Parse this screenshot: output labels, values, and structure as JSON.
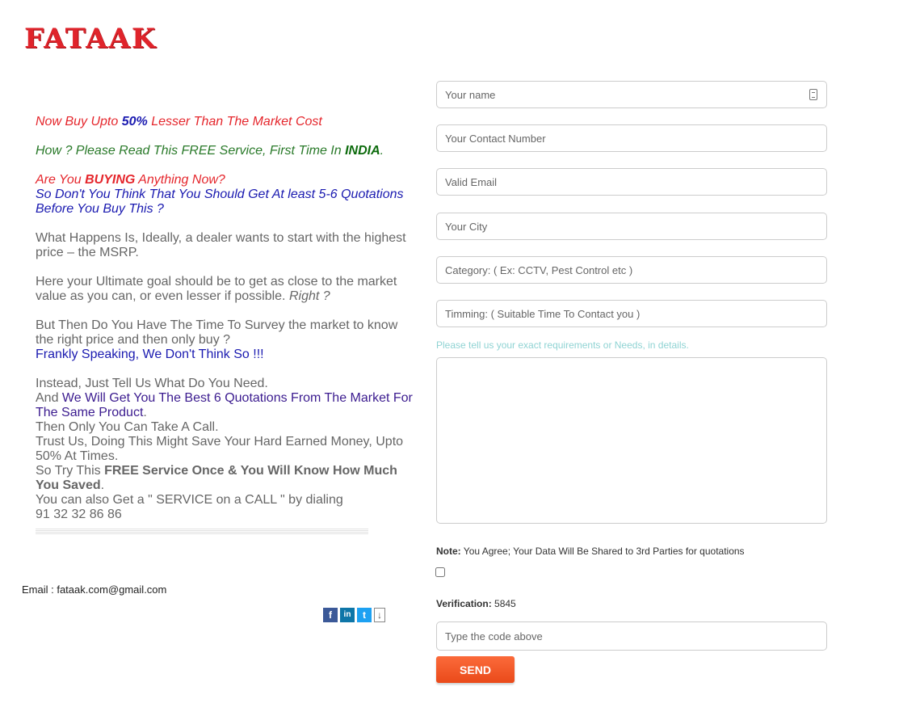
{
  "brand": {
    "logo_text": "FATAAK"
  },
  "pitch": {
    "line1_a": "Now Buy Upto ",
    "line1_b": "50%",
    "line1_c": " Lesser Than The Market Cost",
    "line2_a": "How ? Please Read This FREE Service, First Time In ",
    "line2_b": "INDIA",
    "line2_c": ".",
    "line3_a": "Are You ",
    "line3_b": "BUYING",
    "line3_c": " Anything Now?",
    "line4": "So Don't You Think That You Should Get At least 5-6 Quotations Before You Buy This ?",
    "para1": "What Happens Is, Ideally, a dealer wants to start with the highest price – the MSRP.",
    "para2_a": "Here your Ultimate goal should be to get as close to the market value as you can, or even lesser if possible. ",
    "para2_b": "Right ?",
    "para3_a": "But Then Do You Have The Time To Survey the market to know the right price and then only buy ?",
    "para3_b": "Frankly Speaking, We Don't Think So !!!",
    "para4_a": "Instead, Just Tell Us What Do You Need.",
    "para4_b": "And ",
    "para4_c": "We Will Get You The Best 6 Quotations From The Market For The Same Product",
    "para4_d": ".",
    "para4_e": "Then Only You Can Take A Call.",
    "para4_f": "Trust Us, Doing This Might Save Your Hard Earned Money, Upto 50% At Times.",
    "para4_g": "So Try This ",
    "para4_h": "FREE Service Once & You Will Know How Much You Saved",
    "para4_i": ".",
    "para4_j": "You can also Get a \" SERVICE on a CALL \" by dialing",
    "phone": "91 32 32 86 86"
  },
  "contact": {
    "email": "Email : fataak.com@gmail.com"
  },
  "social": {
    "icons": [
      "facebook-icon",
      "linkedin-icon",
      "twitter-icon",
      "download-icon"
    ]
  },
  "form": {
    "name_placeholder": "Your name",
    "contact_placeholder": "Your Contact Number",
    "email_placeholder": "Valid Email",
    "city_placeholder": "Your City",
    "category_placeholder": "Category: ( Ex: CCTV, Pest Control etc )",
    "timing_placeholder": "Timming: ( Suitable Time To Contact you )",
    "requirements_hint": "Please tell us your exact requirements or Needs, in details.",
    "note_label": "Note:",
    "note_text": " You Agree; Your Data Will Be Shared to 3rd Parties for quotations",
    "verification_label": "Verification:",
    "verification_code": " 5845",
    "code_placeholder": "Type the code above",
    "send_label": "SEND"
  },
  "colors": {
    "accent": "#f25a2a",
    "logo": "#e0242b",
    "hint": "#8fd3d3"
  }
}
